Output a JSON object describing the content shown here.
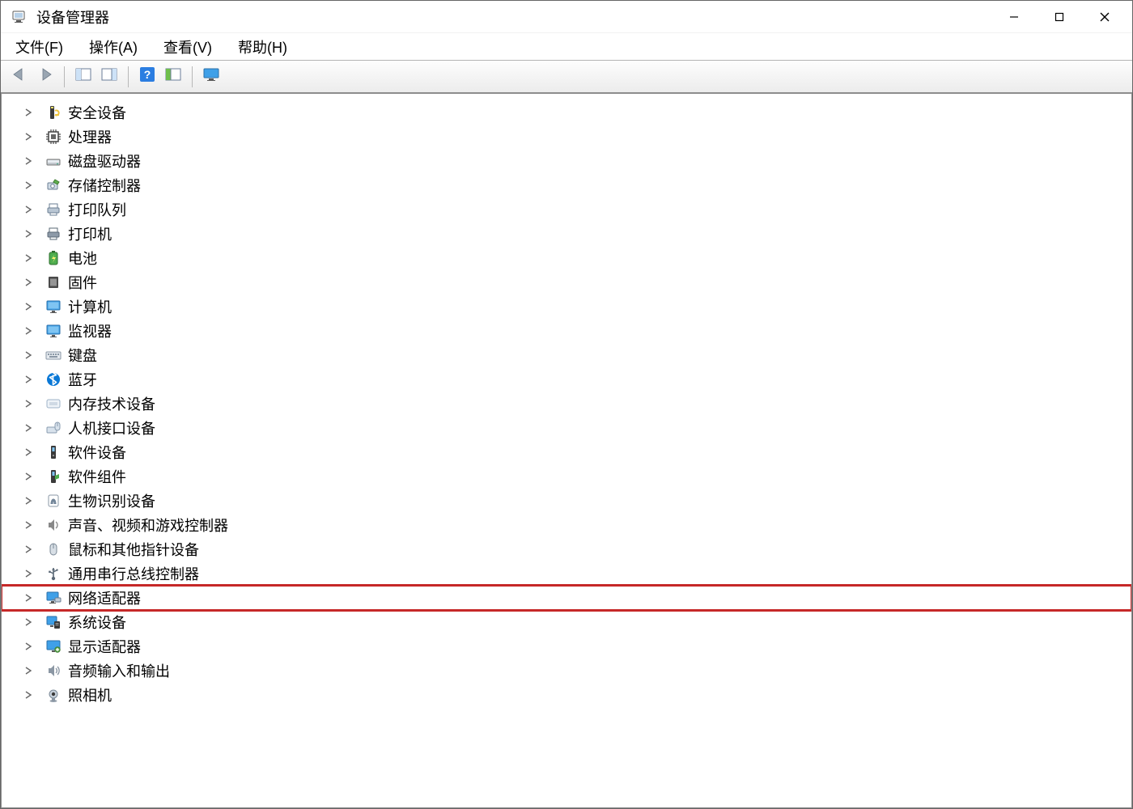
{
  "title": "设备管理器",
  "menu": {
    "file": "文件(F)",
    "action": "操作(A)",
    "view": "查看(V)",
    "help": "帮助(H)"
  },
  "toolbar": {
    "back": "返回",
    "forward": "前进",
    "details": "详细信息",
    "properties": "属性",
    "help": "帮助",
    "scan": "扫描硬件更改",
    "monitor": "显示设备"
  },
  "device_categories": [
    {
      "key": "security-devices",
      "label": "安全设备",
      "icon": "security",
      "highlighted": false
    },
    {
      "key": "processors",
      "label": "处理器",
      "icon": "cpu",
      "highlighted": false
    },
    {
      "key": "disk-drives",
      "label": "磁盘驱动器",
      "icon": "disk",
      "highlighted": false
    },
    {
      "key": "storage-controllers",
      "label": "存储控制器",
      "icon": "storage",
      "highlighted": false
    },
    {
      "key": "print-queues",
      "label": "打印队列",
      "icon": "printqueue",
      "highlighted": false
    },
    {
      "key": "printers",
      "label": "打印机",
      "icon": "printer",
      "highlighted": false
    },
    {
      "key": "batteries",
      "label": "电池",
      "icon": "battery",
      "highlighted": false
    },
    {
      "key": "firmware",
      "label": "固件",
      "icon": "firmware",
      "highlighted": false
    },
    {
      "key": "computer",
      "label": "计算机",
      "icon": "monitor",
      "highlighted": false
    },
    {
      "key": "monitors",
      "label": "监视器",
      "icon": "monitor",
      "highlighted": false
    },
    {
      "key": "keyboards",
      "label": "键盘",
      "icon": "keyboard",
      "highlighted": false
    },
    {
      "key": "bluetooth",
      "label": "蓝牙",
      "icon": "bluetooth",
      "highlighted": false
    },
    {
      "key": "memory-tech-devices",
      "label": "内存技术设备",
      "icon": "memory",
      "highlighted": false
    },
    {
      "key": "hid",
      "label": "人机接口设备",
      "icon": "hid",
      "highlighted": false
    },
    {
      "key": "software-devices",
      "label": "软件设备",
      "icon": "software",
      "highlighted": false
    },
    {
      "key": "software-components",
      "label": "软件组件",
      "icon": "component",
      "highlighted": false
    },
    {
      "key": "biometric",
      "label": "生物识别设备",
      "icon": "biometric",
      "highlighted": false
    },
    {
      "key": "sound-video-game",
      "label": "声音、视频和游戏控制器",
      "icon": "speaker",
      "highlighted": false
    },
    {
      "key": "mice-pointing",
      "label": "鼠标和其他指针设备",
      "icon": "mouse",
      "highlighted": false
    },
    {
      "key": "usb-controllers",
      "label": "通用串行总线控制器",
      "icon": "usb",
      "highlighted": false
    },
    {
      "key": "network-adapters",
      "label": "网络适配器",
      "icon": "network",
      "highlighted": true
    },
    {
      "key": "system-devices",
      "label": "系统设备",
      "icon": "system",
      "highlighted": false
    },
    {
      "key": "display-adapters",
      "label": "显示适配器",
      "icon": "display",
      "highlighted": false
    },
    {
      "key": "audio-io",
      "label": "音频输入和输出",
      "icon": "audio",
      "highlighted": false
    },
    {
      "key": "cameras",
      "label": "照相机",
      "icon": "camera",
      "highlighted": false
    }
  ]
}
